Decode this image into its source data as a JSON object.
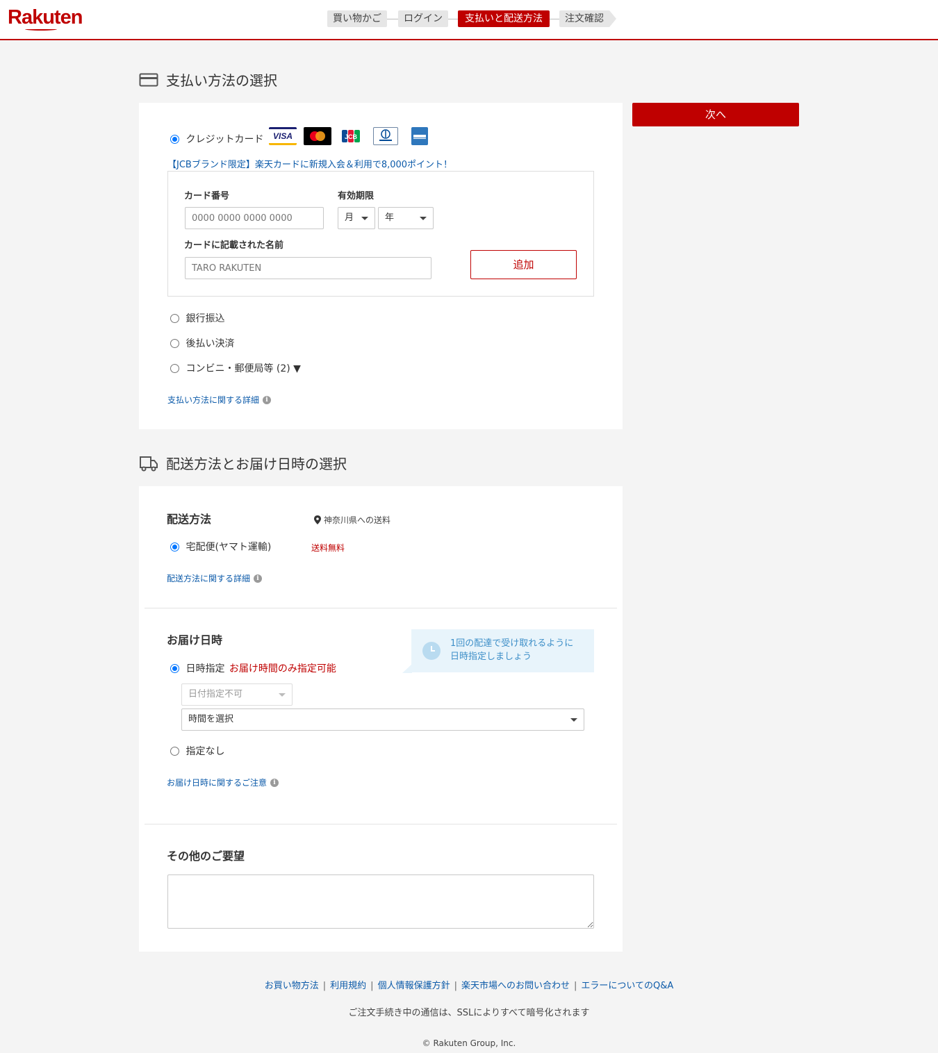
{
  "header": {
    "logo_text": "Rakuten",
    "steps": [
      "買い物かご",
      "ログイン",
      "支払いと配送方法",
      "注文確認"
    ],
    "active_step": 2
  },
  "payment": {
    "title": "支払い方法の選択",
    "credit_label": "クレジットカード",
    "card_brands": [
      "VISA",
      "mastercard",
      "JCB",
      "Diners Club",
      "AMERICAN EXPRESS"
    ],
    "promo": "【JCBブランド限定】楽天カードに新規入会＆利用で8,000ポイント！",
    "card_number_label": "カード番号",
    "card_number_placeholder": "0000 0000 0000 0000",
    "expiry_label": "有効期限",
    "month_value": "月",
    "year_value": "年",
    "name_label": "カードに記載された名前",
    "name_placeholder": "TARO RAKUTEN",
    "add_button": "追加",
    "options": [
      "銀行振込",
      "後払い決済",
      "コンビニ・郵便局等 (2) ▼"
    ],
    "details_link": "支払い方法に関する詳細"
  },
  "next_button": "次へ",
  "delivery": {
    "title": "配送方法とお届け日時の選択",
    "method_heading": "配送方法",
    "destination": "神奈川県への送料",
    "method_option": "宅配便(ヤマト運輸)",
    "shipping_fee": "送料無料",
    "method_link": "配送方法に関する詳細",
    "date_heading": "お届け日時",
    "tip_line1": "1回の配達で受け取れるように",
    "tip_line2": "日時指定しましょう",
    "date_option": "日時指定",
    "date_note": "お届け時間のみ指定可能",
    "date_select": "日付指定不可",
    "time_select": "時間を選択",
    "no_date_option": "指定なし",
    "date_link": "お届け日時に関するご注意"
  },
  "other": {
    "heading": "その他のご要望"
  },
  "footer": {
    "links": [
      "お買い物方法",
      "利用規約",
      "個人情報保護方針",
      "楽天市場へのお問い合わせ",
      "エラーについてのQ&A"
    ],
    "ssl_note": "ご注文手続き中の通信は、SSLによりすべて暗号化されます",
    "copyright": "© Rakuten Group, Inc."
  },
  "colors": {
    "brand": "#bf0000",
    "link": "#0b5aa9",
    "tip_text": "#3e8fc8"
  }
}
